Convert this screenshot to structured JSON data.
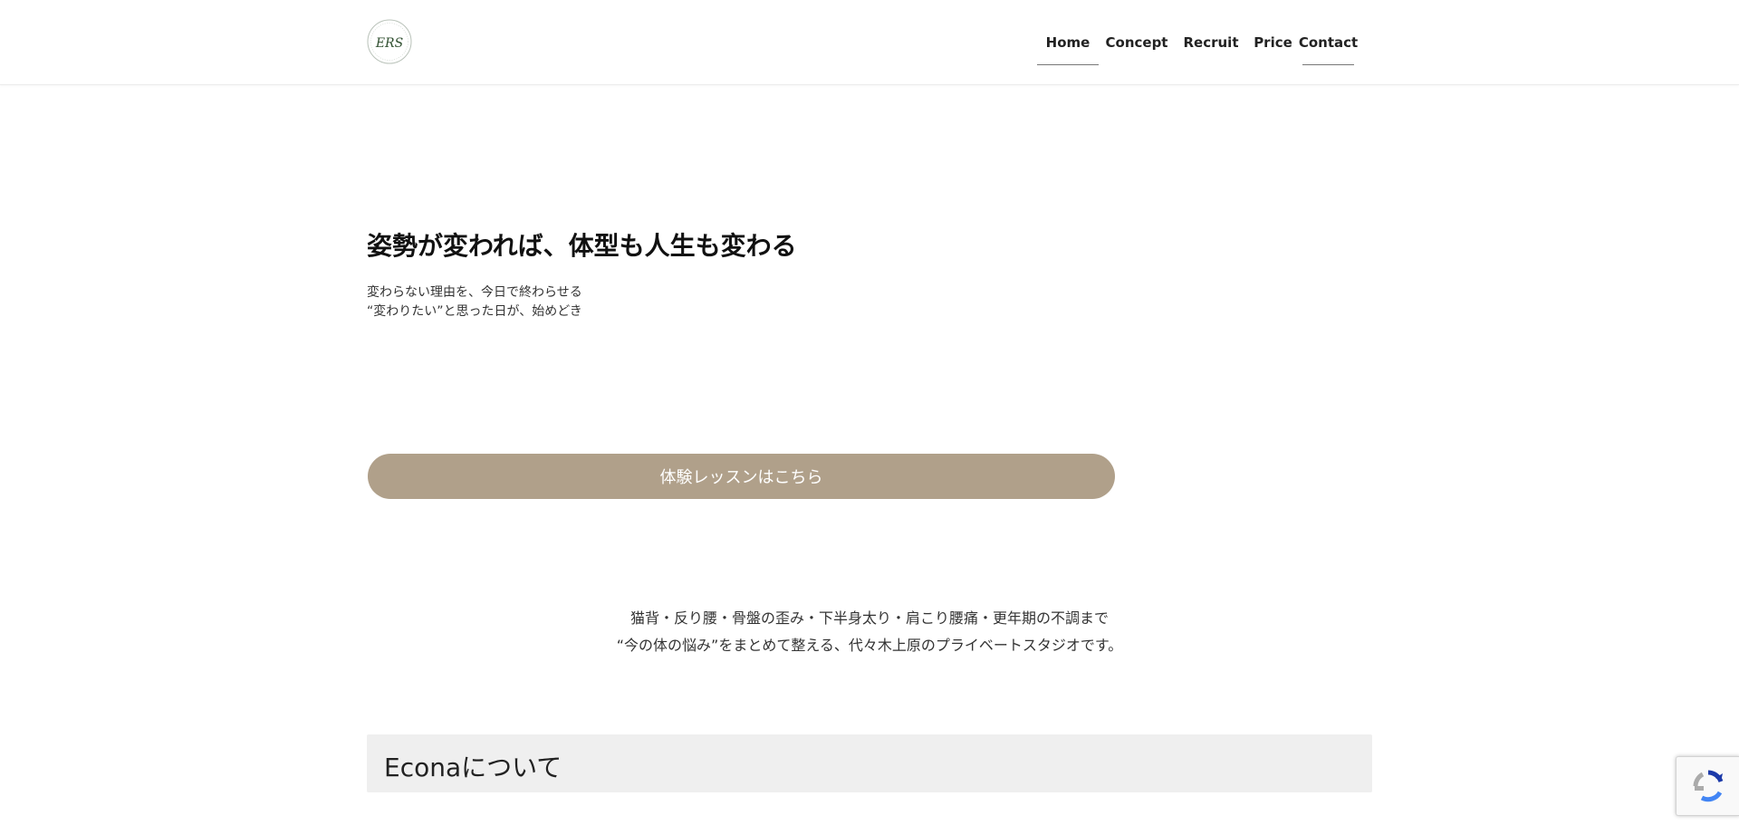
{
  "header": {
    "logo_text": "ERS",
    "nav": [
      {
        "label": "Home",
        "active": true
      },
      {
        "label": "Concept",
        "active": false
      },
      {
        "label": "Recruit",
        "active": false
      },
      {
        "label": "Price",
        "active": false
      },
      {
        "label": "Contact",
        "active": true
      }
    ]
  },
  "hero": {
    "title": "姿勢が変われば、体型も人生も変わる",
    "subtitle_lines": [
      "変わらない理由を、今日で終わらせる",
      "“変わりたい”と思った日が、始めどき"
    ],
    "cta_label": "体験レッスンはこちら"
  },
  "intro": {
    "lines": [
      "猫背・反り腰・骨盤の歪み・下半身太り・肩こり腰痛・更年期の不調まで",
      "“今の体の悩み”をまとめて整える、代々木上原のプライベートスタジオです。"
    ]
  },
  "about_section": {
    "title": "Econaについて"
  },
  "recaptcha": {
    "icon": "recaptcha-icon"
  },
  "colors": {
    "accent": "#b0a08a",
    "section_bg": "#efefef",
    "logo_green": "#2f4f2f"
  }
}
